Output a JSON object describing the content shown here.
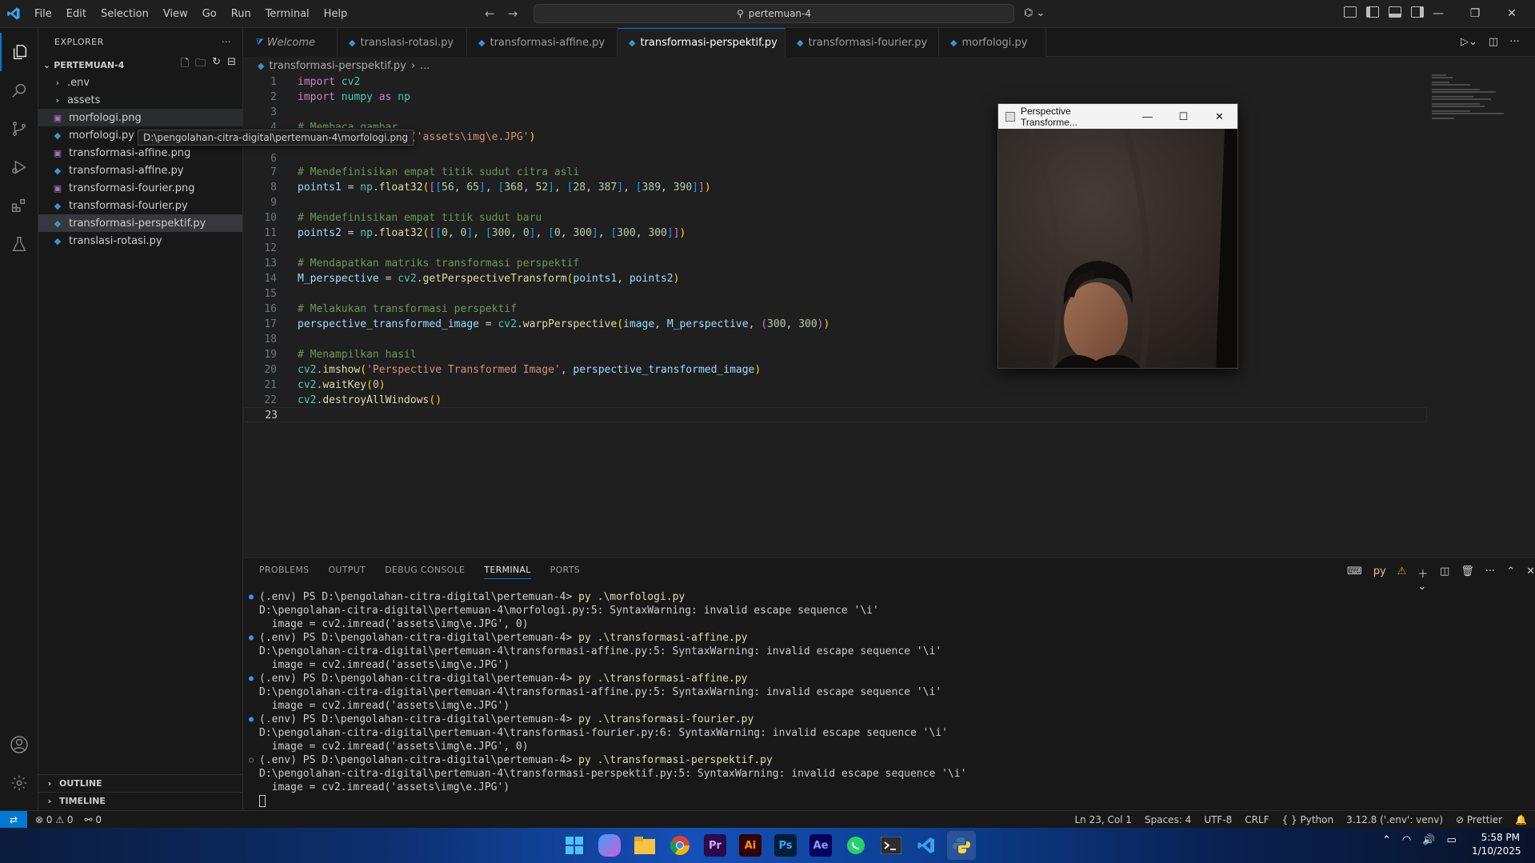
{
  "titlebar": {
    "menu": [
      "File",
      "Edit",
      "Selection",
      "View",
      "Go",
      "Run",
      "Terminal",
      "Help"
    ],
    "command_center": "pertemuan-4"
  },
  "explorer": {
    "title": "EXPLORER",
    "folder": "PERTEMUAN-4",
    "items": [
      {
        "label": ".env",
        "kind": "folder"
      },
      {
        "label": "assets",
        "kind": "folder"
      },
      {
        "label": "morfologi.png",
        "kind": "png"
      },
      {
        "label": "morfologi.py",
        "kind": "py"
      },
      {
        "label": "transformasi-affine.png",
        "kind": "png"
      },
      {
        "label": "transformasi-affine.py",
        "kind": "py"
      },
      {
        "label": "transformasi-fourier.png",
        "kind": "png"
      },
      {
        "label": "transformasi-fourier.py",
        "kind": "py"
      },
      {
        "label": "transformasi-perspektif.py",
        "kind": "py"
      },
      {
        "label": "translasi-rotasi.py",
        "kind": "py"
      }
    ],
    "tooltip": "D:\\pengolahan-citra-digital\\pertemuan-4\\morfologi.png",
    "outline": "OUTLINE",
    "timeline": "TIMELINE"
  },
  "tabs": [
    "Welcome",
    "translasi-rotasi.py",
    "transformasi-affine.py",
    "transformasi-perspektif.py",
    "transformasi-fourier.py",
    "morfologi.py"
  ],
  "breadcrumb": {
    "file": "transformasi-perspektif.py",
    "rest": "..."
  },
  "editor": {
    "line_numbers": [
      "1",
      "2",
      "3",
      "4",
      "6",
      "7",
      "8",
      "9",
      "10",
      "11",
      "12",
      "13",
      "14",
      "15",
      "16",
      "17",
      "18",
      "19",
      "20",
      "21",
      "22",
      "23"
    ]
  },
  "cv_window": {
    "title": "Perspective Transforme..."
  },
  "panel": {
    "tabs": [
      "PROBLEMS",
      "OUTPUT",
      "DEBUG CONSOLE",
      "TERMINAL",
      "PORTS"
    ],
    "terminal_lines": [
      {
        "prompt": "(.env) PS D:\\pengolahan-citra-digital\\pertemuan-4> ",
        "cmd": "py .\\morfologi.py",
        "dot": "filled"
      },
      {
        "text": "D:\\pengolahan-citra-digital\\pertemuan-4\\morfologi.py:5: SyntaxWarning: invalid escape sequence '\\i'"
      },
      {
        "text": "  image = cv2.imread('assets\\img\\e.JPG', 0)"
      },
      {
        "prompt": "(.env) PS D:\\pengolahan-citra-digital\\pertemuan-4> ",
        "cmd": "py .\\transformasi-affine.py",
        "dot": "filled"
      },
      {
        "text": "D:\\pengolahan-citra-digital\\pertemuan-4\\transformasi-affine.py:5: SyntaxWarning: invalid escape sequence '\\i'"
      },
      {
        "text": "  image = cv2.imread('assets\\img\\e.JPG')"
      },
      {
        "prompt": "(.env) PS D:\\pengolahan-citra-digital\\pertemuan-4> ",
        "cmd": "py .\\transformasi-affine.py",
        "dot": "filled"
      },
      {
        "text": "D:\\pengolahan-citra-digital\\pertemuan-4\\transformasi-affine.py:5: SyntaxWarning: invalid escape sequence '\\i'"
      },
      {
        "text": "  image = cv2.imread('assets\\img\\e.JPG')"
      },
      {
        "prompt": "(.env) PS D:\\pengolahan-citra-digital\\pertemuan-4> ",
        "cmd": "py .\\transformasi-fourier.py",
        "dot": "filled"
      },
      {
        "text": "D:\\pengolahan-citra-digital\\pertemuan-4\\transformasi-fourier.py:6: SyntaxWarning: invalid escape sequence '\\i'"
      },
      {
        "text": "  image = cv2.imread('assets\\img\\e.JPG', 0)"
      },
      {
        "prompt": "(.env) PS D:\\pengolahan-citra-digital\\pertemuan-4> ",
        "cmd": "py .\\transformasi-perspektif.py",
        "dot": "hollow"
      },
      {
        "text": "D:\\pengolahan-citra-digital\\pertemuan-4\\transformasi-perspektif.py:5: SyntaxWarning: invalid escape sequence '\\i'"
      },
      {
        "text": "  image = cv2.imread('assets\\img\\e.JPG')"
      }
    ],
    "terminal_tag": "py"
  },
  "statusbar": {
    "errors": "0",
    "warnings": "0",
    "ports": "0",
    "position": "Ln 23, Col 1",
    "spaces": "Spaces: 4",
    "encoding": "UTF-8",
    "eol": "CRLF",
    "language": "Python",
    "interpreter": "3.12.8 ('.env': venv)",
    "formatter": "Prettier"
  },
  "taskbar": {
    "apps": [
      "Start",
      "Copilot",
      "File Explorer",
      "Chrome",
      "Premiere Pro",
      "Illustrator",
      "Photoshop",
      "After Effects",
      "WhatsApp",
      "Terminal",
      "VS Code",
      "Python"
    ],
    "app_labels": {
      "pr": "Pr",
      "ai": "Ai",
      "ps": "Ps",
      "ae": "Ae"
    },
    "time": "5:58 PM",
    "date": "1/10/2025"
  },
  "colors": {
    "accent": "#0078d4",
    "comment": "#6a9955",
    "string": "#ce9178",
    "keyword": "#c586c0",
    "function": "#dcdcaa",
    "variable": "#9cdcfe",
    "number": "#b5cea8"
  }
}
